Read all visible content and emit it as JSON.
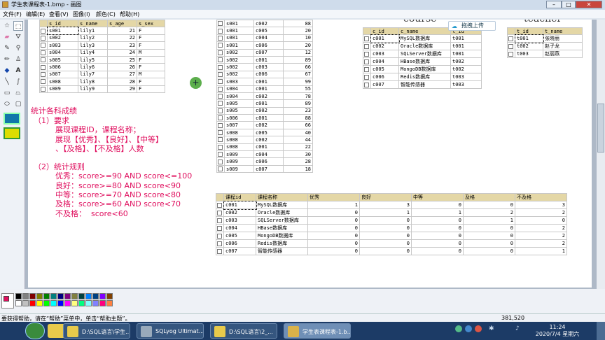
{
  "window": {
    "title": "学生表课程表-1.bmp - 画图",
    "controls": [
      "–",
      "□",
      "✕"
    ]
  },
  "menu": [
    "文件(F)",
    "编辑(E)",
    "查看(V)",
    "图像(I)",
    "颜色(C)",
    "帮助(H)"
  ],
  "toolbox": {
    "tools": [
      "free-select",
      "rect-select",
      "eraser",
      "fill",
      "eyedropper",
      "zoom",
      "pencil",
      "brush",
      "airbrush",
      "text",
      "line",
      "curve",
      "rectangle",
      "polygon",
      "ellipse",
      "rounded-rect"
    ]
  },
  "student": {
    "headers": [
      "s_id",
      "s_name",
      "s_age",
      "s_sex"
    ],
    "rows": [
      [
        "s001",
        "lily1",
        "21",
        "F"
      ],
      [
        "s002",
        "lily2",
        "22",
        "F"
      ],
      [
        "s003",
        "lily3",
        "23",
        "F"
      ],
      [
        "s004",
        "lily4",
        "24",
        "M"
      ],
      [
        "s005",
        "lily5",
        "25",
        "F"
      ],
      [
        "s006",
        "lily6",
        "26",
        "F"
      ],
      [
        "s007",
        "lily7",
        "27",
        "M"
      ],
      [
        "s008",
        "lily8",
        "28",
        "F"
      ],
      [
        "s009",
        "lily9",
        "29",
        "F"
      ]
    ]
  },
  "score": {
    "rows": [
      [
        "s001",
        "c002",
        "88"
      ],
      [
        "s001",
        "c005",
        "20"
      ],
      [
        "s001",
        "c004",
        "10"
      ],
      [
        "s001",
        "c006",
        "20"
      ],
      [
        "s002",
        "c007",
        "12"
      ],
      [
        "s002",
        "c001",
        "89"
      ],
      [
        "s002",
        "c003",
        "66"
      ],
      [
        "s002",
        "c006",
        "67"
      ],
      [
        "s003",
        "c001",
        "99"
      ],
      [
        "s004",
        "c001",
        "55"
      ],
      [
        "s004",
        "c002",
        "78"
      ],
      [
        "s005",
        "c001",
        "89"
      ],
      [
        "s005",
        "c002",
        "23"
      ],
      [
        "s006",
        "c001",
        "88"
      ],
      [
        "s007",
        "c002",
        "66"
      ],
      [
        "s008",
        "c005",
        "40"
      ],
      [
        "s008",
        "c002",
        "44"
      ],
      [
        "s008",
        "c001",
        "22"
      ],
      [
        "s009",
        "c004",
        "30"
      ],
      [
        "s009",
        "c006",
        "28"
      ],
      [
        "s009",
        "c007",
        "18"
      ]
    ]
  },
  "course": {
    "caption": "course",
    "headers": [
      "c_id",
      "c_name",
      "t_id"
    ],
    "rows": [
      [
        "c001",
        "MySQL数据库",
        "t001"
      ],
      [
        "c002",
        "Oracle数据库",
        "t001"
      ],
      [
        "c003",
        "SQLServer数据库",
        "t001"
      ],
      [
        "c004",
        "HBase数据库",
        "t002"
      ],
      [
        "c005",
        "MongoDB数据库",
        "t002"
      ],
      [
        "c006",
        "Redis数据库",
        "t003"
      ],
      [
        "c007",
        "智能传感器",
        "t003"
      ]
    ]
  },
  "teacher": {
    "caption": "teacher",
    "headers": [
      "t_id",
      "t_name"
    ],
    "rows": [
      [
        "t001",
        "张晓丽"
      ],
      [
        "t002",
        "赵子龙"
      ],
      [
        "t003",
        "赵丽燕"
      ]
    ]
  },
  "upload": {
    "label": "拖拽上传"
  },
  "notes": {
    "title": "统计各科成绩",
    "req_head": "（1）要求",
    "req1": "展现课程ID，课程名称；",
    "req2": "展现【优秀】、【良好】、【中等】",
    "req3": "、【及格】、【不及格】人数",
    "rule_head": "（2）统计规则",
    "r1": "优秀：score>=90 AND score<=100",
    "r2": "良好：score>=80 AND score<90",
    "r3": "中等：score>=70 AND score<80",
    "r4": "及格：score>=60 AND score<70",
    "r5": "不及格：  score<60"
  },
  "result": {
    "headers": [
      "课程id",
      "课程名称",
      "优秀",
      "良好",
      "中等",
      "及格",
      "不及格"
    ],
    "rows": [
      [
        "c001",
        "MySQL数据库",
        "1",
        "3",
        "0",
        "0",
        "3"
      ],
      [
        "c002",
        "Oracle数据库",
        "0",
        "1",
        "1",
        "2",
        "2"
      ],
      [
        "c003",
        "SQLServer数据库",
        "0",
        "0",
        "0",
        "1",
        "0"
      ],
      [
        "c004",
        "HBase数据库",
        "0",
        "0",
        "0",
        "0",
        "2"
      ],
      [
        "c005",
        "MongoDB数据库",
        "0",
        "0",
        "0",
        "0",
        "2"
      ],
      [
        "c006",
        "Redis数据库",
        "0",
        "0",
        "0",
        "0",
        "2"
      ],
      [
        "c007",
        "智能传感器",
        "0",
        "0",
        "0",
        "0",
        "1"
      ]
    ]
  },
  "status": {
    "help": "要获得帮助，请在“帮助”菜单中，单击“帮助主题”。",
    "coords": "381,520"
  },
  "taskbar": {
    "tasks": [
      "D:\\SQL语言\\学生...",
      "SQLyog Ultimat...",
      "D:\\SQL语言\\2_...",
      "学生表课程表-1.b..."
    ],
    "time": "11:24",
    "date": "2020/7/4 星期六"
  },
  "colors": {
    "palette": [
      "#000000",
      "#808080",
      "#800000",
      "#808000",
      "#008000",
      "#008080",
      "#000080",
      "#800080",
      "#808040",
      "#004040",
      "#0080ff",
      "#004080",
      "#8000ff",
      "#804000",
      "#ffffff",
      "#c0c0c0",
      "#ff0000",
      "#ffff00",
      "#00ff00",
      "#00ffff",
      "#0000ff",
      "#ff00ff",
      "#ffff80",
      "#00ff80",
      "#80ffff",
      "#8080ff",
      "#ff0080",
      "#ff8040"
    ],
    "primary": "#e0105f",
    "secondary": "#ffffff"
  }
}
